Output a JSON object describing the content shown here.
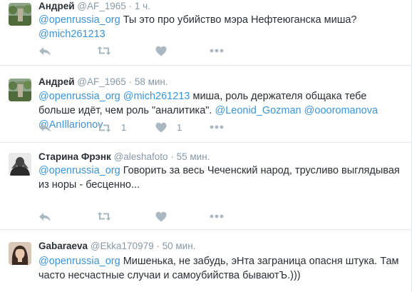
{
  "tweets": [
    {
      "author": "Андрей",
      "handle": "@AF_1965",
      "sep": "·",
      "time": "1 ч.",
      "segments": [
        {
          "t": "@openrussia_org",
          "link": true
        },
        {
          "t": " Ты это про убийство мэра Нефтеюганска миша? ",
          "link": false
        },
        {
          "t": "@mich261213",
          "link": true
        }
      ],
      "retweet_count": "",
      "like_count": ""
    },
    {
      "author": "Андрей",
      "handle": "@AF_1965",
      "sep": "·",
      "time": "58 мин.",
      "segments": [
        {
          "t": "@openrussia_org",
          "link": true
        },
        {
          "t": " ",
          "link": false
        },
        {
          "t": "@mich261213",
          "link": true
        },
        {
          "t": " миша, роль держателя общака тебе больше идёт, чем роль \"аналитика\". ",
          "link": false
        },
        {
          "t": "@Leonid_Gozman",
          "link": true
        },
        {
          "t": " ",
          "link": false
        },
        {
          "t": "@oooromanova",
          "link": true
        },
        {
          "t": " ",
          "link": false
        },
        {
          "t": "@AnIllarionov",
          "link": true
        }
      ],
      "retweet_count": "1",
      "like_count": "1"
    },
    {
      "author": "Старина Фрэнк",
      "handle": "@aleshafoto",
      "sep": "·",
      "time": "55 мин.",
      "segments": [
        {
          "t": "@openrussia_org",
          "link": true
        },
        {
          "t": " Говорить за весь Чеченский народ, трусливо выглядывая из норы - бесценно...",
          "link": false
        }
      ],
      "retweet_count": "",
      "like_count": ""
    },
    {
      "author": "Gabaraeva",
      "handle": "@Ekka170979",
      "sep": "·",
      "time": "50 мин.",
      "segments": [
        {
          "t": "@openrussia_org",
          "link": true
        },
        {
          "t": " Мишенька, не забудь, эНта заграница опасня штука. Там часто несчастные случаи и самоубийства бываютЪ.)))",
          "link": false
        }
      ],
      "retweet_count": "",
      "like_count": ""
    }
  ],
  "icons": {
    "reply": "reply-icon",
    "retweet": "retweet-icon",
    "like": "heart-icon",
    "more": "more-icon"
  },
  "colors": {
    "link": "#3b94d9",
    "muted": "#8899a6",
    "icon": "#aab8c2",
    "border": "#e1e8ed",
    "text": "#292f33"
  }
}
